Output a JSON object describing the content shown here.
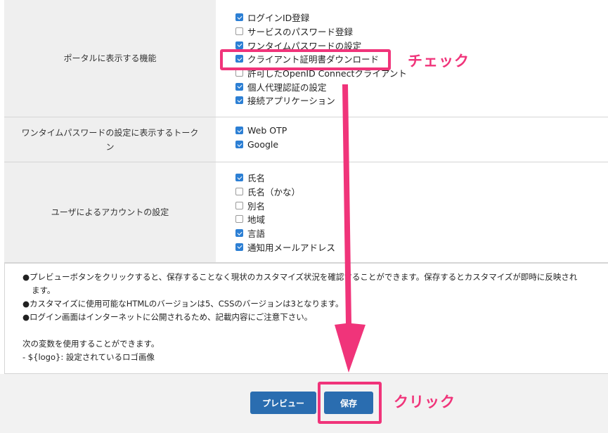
{
  "settings": {
    "portal_features": {
      "label": "ポータルに表示する機能",
      "items": [
        {
          "label": "ログインID登録",
          "checked": true
        },
        {
          "label": "サービスのパスワード登録",
          "checked": false
        },
        {
          "label": "ワンタイムパスワードの設定",
          "checked": true
        },
        {
          "label": "クライアント証明書ダウンロード",
          "checked": true
        },
        {
          "label": "許可したOpenID Connectクライアント",
          "checked": false
        },
        {
          "label": "個人代理認証の設定",
          "checked": true
        },
        {
          "label": "接続アプリケーション",
          "checked": true
        }
      ]
    },
    "otp_tokens": {
      "label": "ワンタイムパスワードの設定に表示するトークン",
      "items": [
        {
          "label": "Web OTP",
          "checked": true
        },
        {
          "label": "Google",
          "checked": true
        }
      ]
    },
    "account_settings": {
      "label": "ユーザによるアカウントの設定",
      "items": [
        {
          "label": "氏名",
          "checked": true
        },
        {
          "label": "氏名（かな）",
          "checked": false
        },
        {
          "label": "別名",
          "checked": false
        },
        {
          "label": "地域",
          "checked": false
        },
        {
          "label": "言語",
          "checked": true
        },
        {
          "label": "通知用メールアドレス",
          "checked": true
        }
      ]
    }
  },
  "notes": {
    "line1": "●プレビューボタンをクリックすると、保存することなく現状のカスタマイズ状況を確認することができます。保存するとカスタマイズが即時に反映され",
    "line1_cont": "ます。",
    "line2": "●カスタマイズに使用可能なHTMLのバージョンは5、CSSのバージョンは3となります。",
    "line3": "●ログイン画面はインターネットに公開されるため、記載内容にご注意下さい。",
    "line4": "次の変数を使用することができます。",
    "line5": "- ${logo}: 設定されているロゴ画像"
  },
  "buttons": {
    "preview": "プレビュー",
    "save": "保存"
  },
  "annotations": {
    "check": "チェック",
    "click": "クリック",
    "color": "#f0347a"
  },
  "colors": {
    "checkbox_checked": "#2c7fd4",
    "button": "#2a6db0",
    "label_bg": "#efefef"
  }
}
